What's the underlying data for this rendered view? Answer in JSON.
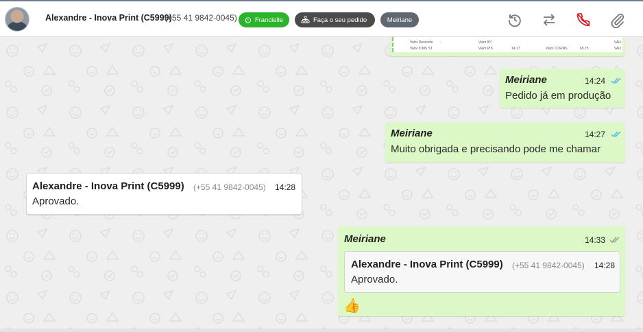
{
  "header": {
    "contact_name": "Alexandre - Inova Print (C5999)",
    "contact_phone": "(+55 41 9842-0045)",
    "tags": {
      "whatsapp_agent": "Francielle",
      "order": "Faça o seu pedido",
      "user": "Meiriane"
    },
    "icons": [
      "history-icon",
      "transfer-icon",
      "end-call-icon",
      "attachment-icon"
    ]
  },
  "colors": {
    "outgoing_bubble": "#dcf8c6",
    "incoming_bubble": "#ffffff",
    "tag_green": "#2bb32b",
    "tag_dark": "#4b4b4b",
    "read_ticks": "#4fb6ec",
    "end_call": "#d8232a"
  },
  "document_preview": {
    "row1": [
      "Valor Desconto",
      ":",
      "Valor IPI",
      "VALI"
    ],
    "row2": [
      "Valor ICMS ST",
      "Valor PIS",
      "14,17",
      "Valor COFINS",
      "65,75",
      "VALI"
    ]
  },
  "messages": [
    {
      "sender": "Meiriane",
      "time": "14:24",
      "text": "Pedido já em produção",
      "status": "read"
    },
    {
      "sender": "Meiriane",
      "time": "14:27",
      "text": "Muito obrigada e precisando pode me chamar",
      "status": "read"
    },
    {
      "sender": "Alexandre - Inova Print (C5999)",
      "phone": "(+55 41 9842-0045)",
      "time": "14:28",
      "text": "Aprovado."
    },
    {
      "sender": "Meiriane",
      "time": "14:33",
      "status": "delivered",
      "quoted": {
        "sender": "Alexandre - Inova Print (C5999)",
        "phone": "(+55 41 9842-0045)",
        "time": "14:28",
        "text": "Aprovado."
      },
      "text": "👍"
    }
  ]
}
